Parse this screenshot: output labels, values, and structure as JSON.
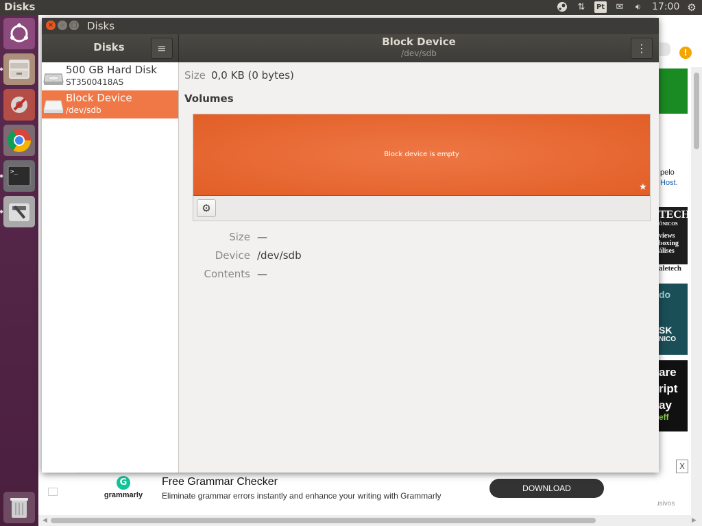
{
  "top_panel": {
    "app_title": "Disks",
    "clock": "17:00",
    "pt_indicator": "Pt",
    "icons": [
      "steam-icon",
      "network-arrows-icon",
      "keyboard-layout-icon",
      "mail-icon",
      "volume-icon",
      "gear-icon"
    ]
  },
  "launcher": {
    "items": [
      "ubuntu-dash-icon",
      "files-icon",
      "system-settings-icon",
      "chrome-icon",
      "terminal-icon",
      "disks-icon",
      "trash-icon"
    ]
  },
  "window": {
    "title": "Disks",
    "sidebar_header": "Disks",
    "main_header": {
      "title": "Block Device",
      "subtitle": "/dev/sdb"
    },
    "devices": [
      {
        "name": "500 GB Hard Disk",
        "sub": "ST3500418AS",
        "selected": false
      },
      {
        "name": "Block Device",
        "sub": "/dev/sdb",
        "selected": true
      }
    ],
    "details": {
      "size_label": "Size",
      "size_value": "0,0 KB (0 bytes)",
      "volumes_heading": "Volumes",
      "volume_bar_text": "Block device is empty",
      "fields": [
        {
          "label": "Size",
          "value": "—"
        },
        {
          "label": "Device",
          "value": "/dev/sdb"
        },
        {
          "label": "Contents",
          "value": "—"
        }
      ]
    }
  },
  "background_page": {
    "ad": {
      "brand": "grammarly",
      "logo_letter": "G",
      "headline": "Free Grammar Checker",
      "description": "Eliminate grammar errors instantly and enhance your writing with Grammarly",
      "button": "DOWNLOAD",
      "close": "X"
    },
    "side_texts": [
      "pelo",
      "Host.",
      "TECH",
      "ÔNICOS",
      "views",
      "boxing",
      "álises",
      "aletech",
      "do",
      "SK",
      "NICO",
      "are",
      "ript",
      "ay",
      "eff",
      "usivos"
    ]
  },
  "colors": {
    "accent": "#f07746",
    "volume_bar": "#e5612a",
    "panel": "#3c3b37",
    "launcher": "#5b2a4f"
  }
}
